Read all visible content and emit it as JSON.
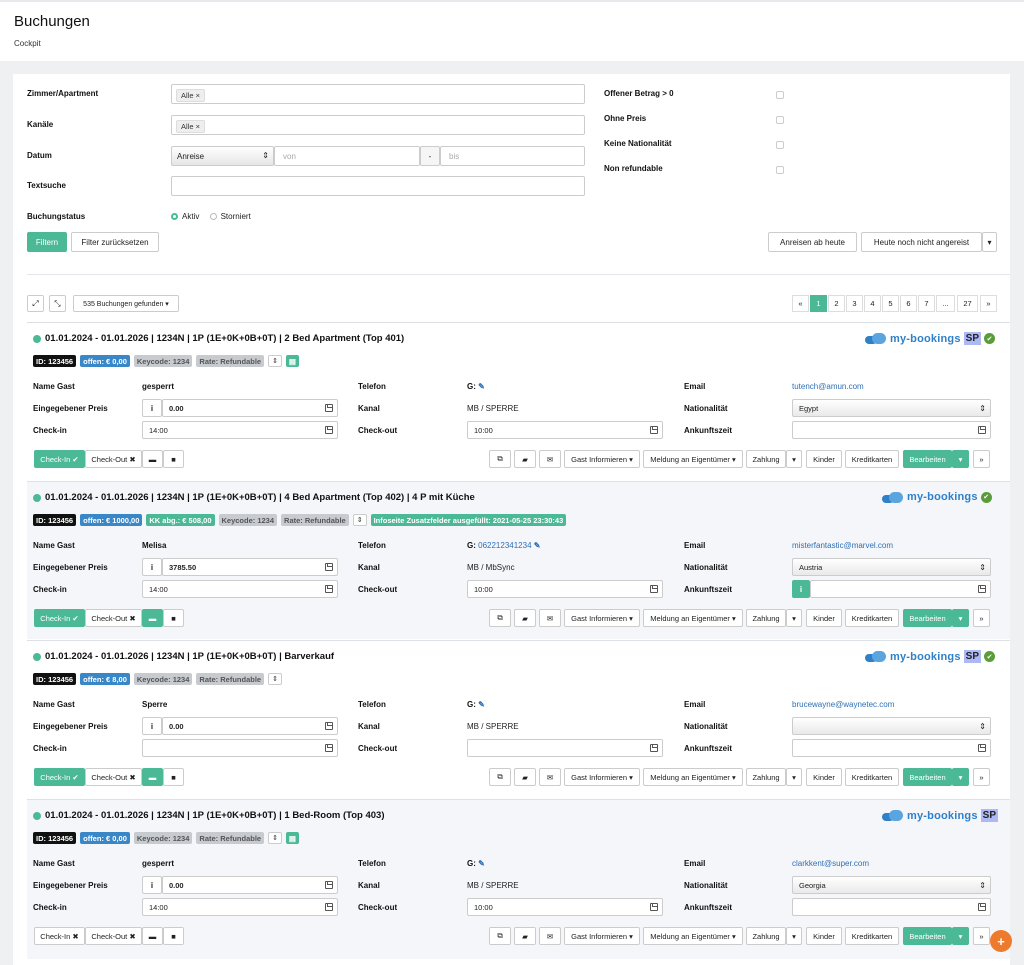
{
  "header": {
    "title": "Buchungen",
    "subtitle": "Cockpit"
  },
  "filter": {
    "zimmer_label": "Zimmer/Apartment",
    "zimmer_tag": "Alle ×",
    "kanaele_label": "Kanäle",
    "kanaele_tag": "Alle ×",
    "datum_label": "Datum",
    "datum_select": "Anreise",
    "von_placeholder": "von",
    "dash": "-",
    "bis_placeholder": "bis",
    "textsuche_label": "Textsuche",
    "status_label": "Buchungstatus",
    "status_aktiv": "Aktiv",
    "status_storniert": "Storniert",
    "offener_label": "Offener Betrag > 0",
    "ohne_preis_label": "Ohne Preis",
    "keine_nat_label": "Keine Nationalität",
    "non_ref_label": "Non refundable",
    "filter_button": "Filtern",
    "reset_button": "Filter zurücksetzen",
    "anreisen_button": "Anreisen ab heute",
    "heute_button": "Heute noch nicht angereist",
    "caret": "▾"
  },
  "toolbar": {
    "found": "535 Buchungen gefunden ▾",
    "expand": "⤢",
    "collapse": "⤡"
  },
  "pagination": [
    "«",
    "1",
    "2",
    "3",
    "4",
    "5",
    "6",
    "7",
    "...",
    "27",
    "»"
  ],
  "labels": {
    "name_gast": "Name Gast",
    "preis": "Eingegebener Preis",
    "checkin": "Check-in",
    "telefon": "Telefon",
    "kanal": "Kanal",
    "checkout": "Check-out",
    "email": "Email",
    "nationalitaet": "Nationalität",
    "ankunftszeit": "Ankunftszeit",
    "g": "G:"
  },
  "actions": {
    "gast_informieren": "Gast Informieren ▾",
    "meldung": "Meldung an Eigentümer ▾",
    "zahlung": "Zahlung",
    "kinder": "Kinder",
    "kreditkarten": "Kreditkarten",
    "bearbeiten": "Bearbeiten",
    "caret": "▾",
    "more": "»",
    "info": "i"
  },
  "logo": {
    "my": "my-",
    "bookings": "bookings",
    "sp": "SP",
    "ok": "✔"
  },
  "bookings": [
    {
      "title": "01.01.2024 - 01.01.2026 | 1234N | 1P (1E+0K+0B+0T) | 2 Bed Apartment (Top 401)",
      "id": "ID: 123456",
      "offen": "offen: € 0,00",
      "kk": "",
      "keycode": "Keycode: 1234",
      "rate": "Rate: Refundable",
      "info": "",
      "name": "gesperrt",
      "phone": "",
      "email": "tutench@amun.com",
      "preis": "0.00",
      "kanal": "MB / SPERRE",
      "nation": "Egypt",
      "checkin": "14:00",
      "checkout": "10:00",
      "ankunft": "",
      "checkin_btn": "Check-In ✔",
      "checkout_btn": "Check-Out ✖"
    },
    {
      "title": "01.01.2024 - 01.01.2026 | 1234N | 1P (1E+0K+0B+0T) |  4 Bed Apartment (Top 402)  | 4 P mit Küche",
      "id": "ID: 123456",
      "offen": "offen: € 1000,00",
      "kk": "KK abg.: € 508,00",
      "keycode": "Keycode: 1234",
      "rate": "Rate: Refundable",
      "info": "Infoseite Zusatzfelder ausgefüllt: 2021-05-25 23:30:43",
      "name": "Melisa",
      "phone": "062212341234",
      "email": "misterfantastic@marvel.com",
      "preis": "3785.50",
      "kanal": "MB / MbSync",
      "nation": "Austria",
      "checkin": "14:00",
      "checkout": "10:00",
      "ankunft": "",
      "checkin_btn": "Check-In ✔",
      "checkout_btn": "Check-Out ✖"
    },
    {
      "title": "01.01.2024 - 01.01.2026 | 1234N | 1P (1E+0K+0B+0T) |  Barverkauf",
      "id": "ID: 123456",
      "offen": "offen: € 8,00",
      "kk": "",
      "keycode": "Keycode: 1234",
      "rate": "Rate: Refundable",
      "info": "",
      "name": "Sperre",
      "phone": "",
      "email": "brucewayne@waynetec.com",
      "preis": "0.00",
      "kanal": "MB / SPERRE",
      "nation": "",
      "checkin": "",
      "checkout": "",
      "ankunft": "",
      "checkin_btn": "Check-In ✔",
      "checkout_btn": "Check-Out ✖"
    },
    {
      "title": "01.01.2024 - 01.01.2026 | 1234N | 1P (1E+0K+0B+0T) |  1 Bed-Room (Top 403)",
      "id": "ID: 123456",
      "offen": "offen: € 0,00",
      "kk": "",
      "keycode": "Keycode: 1234",
      "rate": "Rate: Refundable",
      "info": "",
      "name": "gesperrt",
      "phone": "",
      "email": "clarkkent@super.com",
      "preis": "0.00",
      "kanal": "MB / SPERRE",
      "nation": "Georgia",
      "checkin": "14:00",
      "checkout": "10:00",
      "ankunft": "",
      "checkin_btn": "Check-In ✖",
      "checkout_btn": "Check-Out ✖"
    }
  ],
  "fab": "+"
}
